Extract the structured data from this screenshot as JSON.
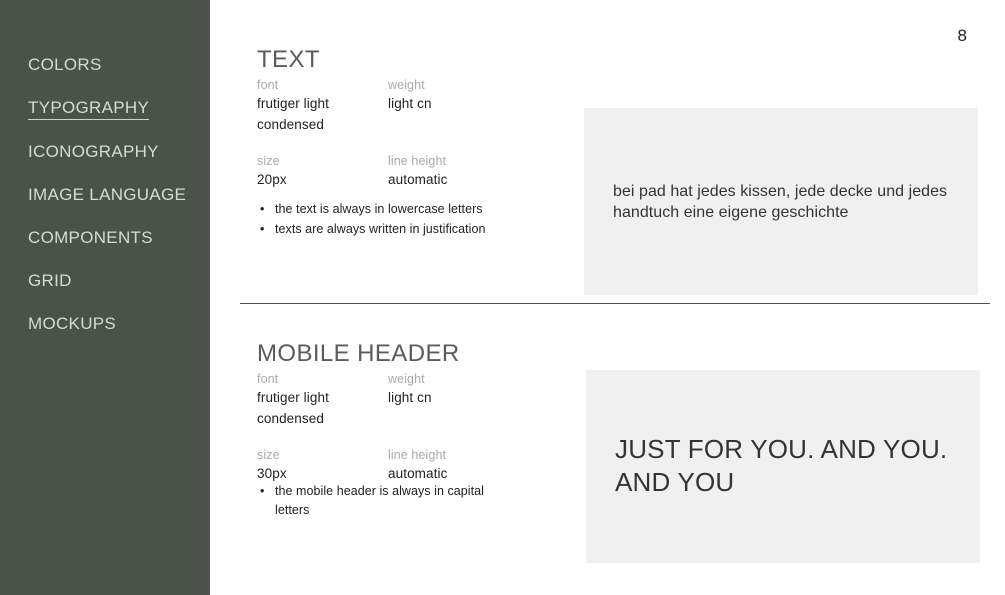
{
  "sidebar": {
    "items": [
      {
        "label": "COLORS",
        "active": false
      },
      {
        "label": "TYPOGRAPHY",
        "active": true
      },
      {
        "label": "ICONOGRAPHY",
        "active": false
      },
      {
        "label": "IMAGE LANGUAGE",
        "active": false
      },
      {
        "label": "COMPONENTS",
        "active": false
      },
      {
        "label": "GRID",
        "active": false
      },
      {
        "label": "MOCKUPS",
        "active": false
      }
    ],
    "background_color": "#4a5249",
    "text_color": "#d8dad6"
  },
  "page": {
    "number": "8",
    "background_color": "#ffffff"
  },
  "sections": [
    {
      "title": "TEXT",
      "specs": [
        [
          {
            "label": "font",
            "value": "frutiger light condensed"
          },
          {
            "label": "weight",
            "value": "light cn"
          }
        ],
        [
          {
            "label": "size",
            "value": "20px"
          },
          {
            "label": "line height",
            "value": "automatic"
          }
        ]
      ],
      "bullets": [
        "the text is always in lowercase letters",
        "texts are always written in justification"
      ],
      "sample": {
        "text": "bei pad hat jedes kissen, jede decke und jedes handtuch eine eigene geschichte",
        "background_color": "#f0f0f0",
        "text_color": "#333333"
      }
    },
    {
      "title": "MOBILE HEADER",
      "specs": [
        [
          {
            "label": "font",
            "value": "frutiger light condensed"
          },
          {
            "label": "weight",
            "value": "light cn"
          }
        ],
        [
          {
            "label": "size",
            "value": "30px"
          },
          {
            "label": "line height",
            "value": "automatic"
          }
        ]
      ],
      "bullets": [
        "the mobile header is always in capital letters"
      ],
      "sample": {
        "text": "JUST FOR YOU. AND YOU. AND YOU",
        "background_color": "#f0f0f0",
        "text_color": "#333333"
      }
    }
  ],
  "divider": {
    "color": "#4e544d"
  }
}
